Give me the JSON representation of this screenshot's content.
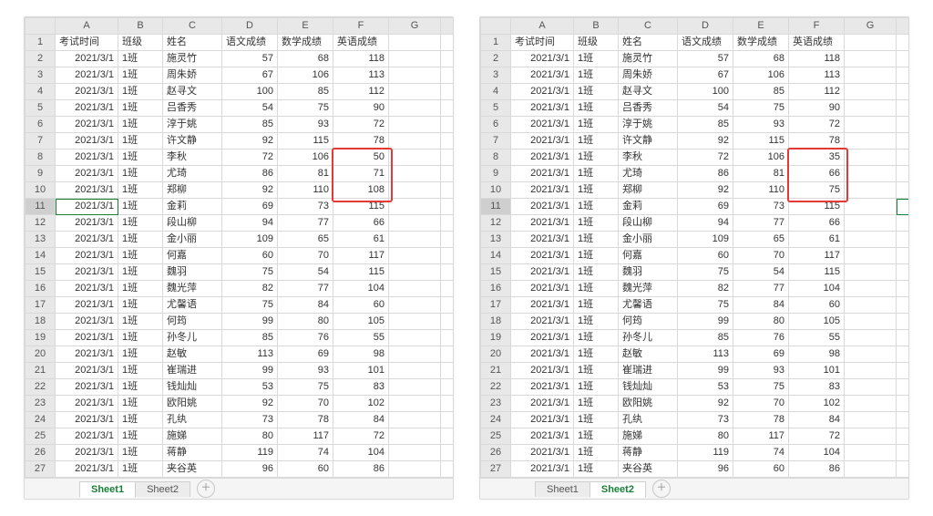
{
  "columns": [
    "A",
    "B",
    "C",
    "D",
    "E",
    "F",
    "G",
    "H"
  ],
  "header_row": [
    "考试时间",
    "班级",
    "姓名",
    "语文成绩",
    "数学成绩",
    "英语成绩",
    "",
    ""
  ],
  "names": [
    "施灵竹",
    "周朱娇",
    "赵寻文",
    "吕香秀",
    "淳于姚",
    "许文静",
    "李秋",
    "尤琦",
    "郑柳",
    "金莉",
    "段山柳",
    "金小丽",
    "何嘉",
    "魏羽",
    "魏光萍",
    "尤馨语",
    "何筠",
    "孙冬儿",
    "赵敏",
    "崔瑞进",
    "钱灿灿",
    "欧阳姚",
    "孔纨",
    "施娣",
    "蒋静",
    "夹谷英"
  ],
  "date": "2021/3/1",
  "class": "1班",
  "base_scores": [
    [
      57,
      68,
      118
    ],
    [
      67,
      106,
      113
    ],
    [
      100,
      85,
      112
    ],
    [
      54,
      75,
      90
    ],
    [
      85,
      93,
      72
    ],
    [
      92,
      115,
      78
    ],
    [
      72,
      106,
      null
    ],
    [
      86,
      81,
      null
    ],
    [
      92,
      110,
      null
    ],
    [
      69,
      73,
      115
    ],
    [
      94,
      77,
      66
    ],
    [
      109,
      65,
      61
    ],
    [
      60,
      70,
      117
    ],
    [
      75,
      54,
      115
    ],
    [
      82,
      77,
      104
    ],
    [
      75,
      84,
      60
    ],
    [
      99,
      80,
      105
    ],
    [
      85,
      76,
      55
    ],
    [
      113,
      69,
      98
    ],
    [
      99,
      93,
      101
    ],
    [
      53,
      75,
      83
    ],
    [
      92,
      70,
      102
    ],
    [
      73,
      78,
      84
    ],
    [
      80,
      117,
      72
    ],
    [
      119,
      74,
      104
    ],
    [
      96,
      60,
      86
    ]
  ],
  "panes": [
    {
      "id": "left",
      "active_tab": "Sheet1",
      "english_override": {
        "7": 50,
        "8": 71,
        "9": 108
      },
      "highlight_rows": [
        8,
        9,
        10
      ],
      "selected_cell": {
        "row": 11,
        "col": "A"
      }
    },
    {
      "id": "right",
      "active_tab": "Sheet2",
      "english_override": {
        "7": 35,
        "8": 66,
        "9": 75
      },
      "highlight_rows": [
        8,
        9,
        10
      ],
      "selected_cell": {
        "row": 11,
        "col": "H"
      }
    }
  ],
  "tabs": [
    "Sheet1",
    "Sheet2"
  ],
  "add_sheet_glyph": "＋",
  "chart_data": {
    "type": "table",
    "title": "Two spreadsheet views (Sheet1 vs Sheet2) with differing English scores in rows 8–10",
    "columns": [
      "考试时间",
      "班级",
      "姓名",
      "语文成绩",
      "数学成绩",
      "英语成绩(Sheet1)",
      "英语成绩(Sheet2)"
    ],
    "rows": [
      [
        "2021/3/1",
        "1班",
        "施灵竹",
        57,
        68,
        118,
        118
      ],
      [
        "2021/3/1",
        "1班",
        "周朱娇",
        67,
        106,
        113,
        113
      ],
      [
        "2021/3/1",
        "1班",
        "赵寻文",
        100,
        85,
        112,
        112
      ],
      [
        "2021/3/1",
        "1班",
        "吕香秀",
        54,
        75,
        90,
        90
      ],
      [
        "2021/3/1",
        "1班",
        "淳于姚",
        85,
        93,
        72,
        72
      ],
      [
        "2021/3/1",
        "1班",
        "许文静",
        92,
        115,
        78,
        78
      ],
      [
        "2021/3/1",
        "1班",
        "李秋",
        72,
        106,
        50,
        35
      ],
      [
        "2021/3/1",
        "1班",
        "尤琦",
        86,
        81,
        71,
        66
      ],
      [
        "2021/3/1",
        "1班",
        "郑柳",
        92,
        110,
        108,
        75
      ],
      [
        "2021/3/1",
        "1班",
        "金莉",
        69,
        73,
        115,
        115
      ],
      [
        "2021/3/1",
        "1班",
        "段山柳",
        94,
        77,
        66,
        66
      ],
      [
        "2021/3/1",
        "1班",
        "金小丽",
        109,
        65,
        61,
        61
      ],
      [
        "2021/3/1",
        "1班",
        "何嘉",
        60,
        70,
        117,
        117
      ],
      [
        "2021/3/1",
        "1班",
        "魏羽",
        75,
        54,
        115,
        115
      ],
      [
        "2021/3/1",
        "1班",
        "魏光萍",
        82,
        77,
        104,
        104
      ],
      [
        "2021/3/1",
        "1班",
        "尤馨语",
        75,
        84,
        60,
        60
      ],
      [
        "2021/3/1",
        "1班",
        "何筠",
        99,
        80,
        105,
        105
      ],
      [
        "2021/3/1",
        "1班",
        "孙冬儿",
        85,
        76,
        55,
        55
      ],
      [
        "2021/3/1",
        "1班",
        "赵敏",
        113,
        69,
        98,
        98
      ],
      [
        "2021/3/1",
        "1班",
        "崔瑞进",
        99,
        93,
        101,
        101
      ],
      [
        "2021/3/1",
        "1班",
        "钱灿灿",
        53,
        75,
        83,
        83
      ],
      [
        "2021/3/1",
        "1班",
        "欧阳姚",
        92,
        70,
        102,
        102
      ],
      [
        "2021/3/1",
        "1班",
        "孔纨",
        73,
        78,
        84,
        84
      ],
      [
        "2021/3/1",
        "1班",
        "施娣",
        80,
        117,
        72,
        72
      ],
      [
        "2021/3/1",
        "1班",
        "蒋静",
        119,
        74,
        104,
        104
      ],
      [
        "2021/3/1",
        "1班",
        "夹谷英",
        96,
        60,
        86,
        86
      ]
    ]
  }
}
